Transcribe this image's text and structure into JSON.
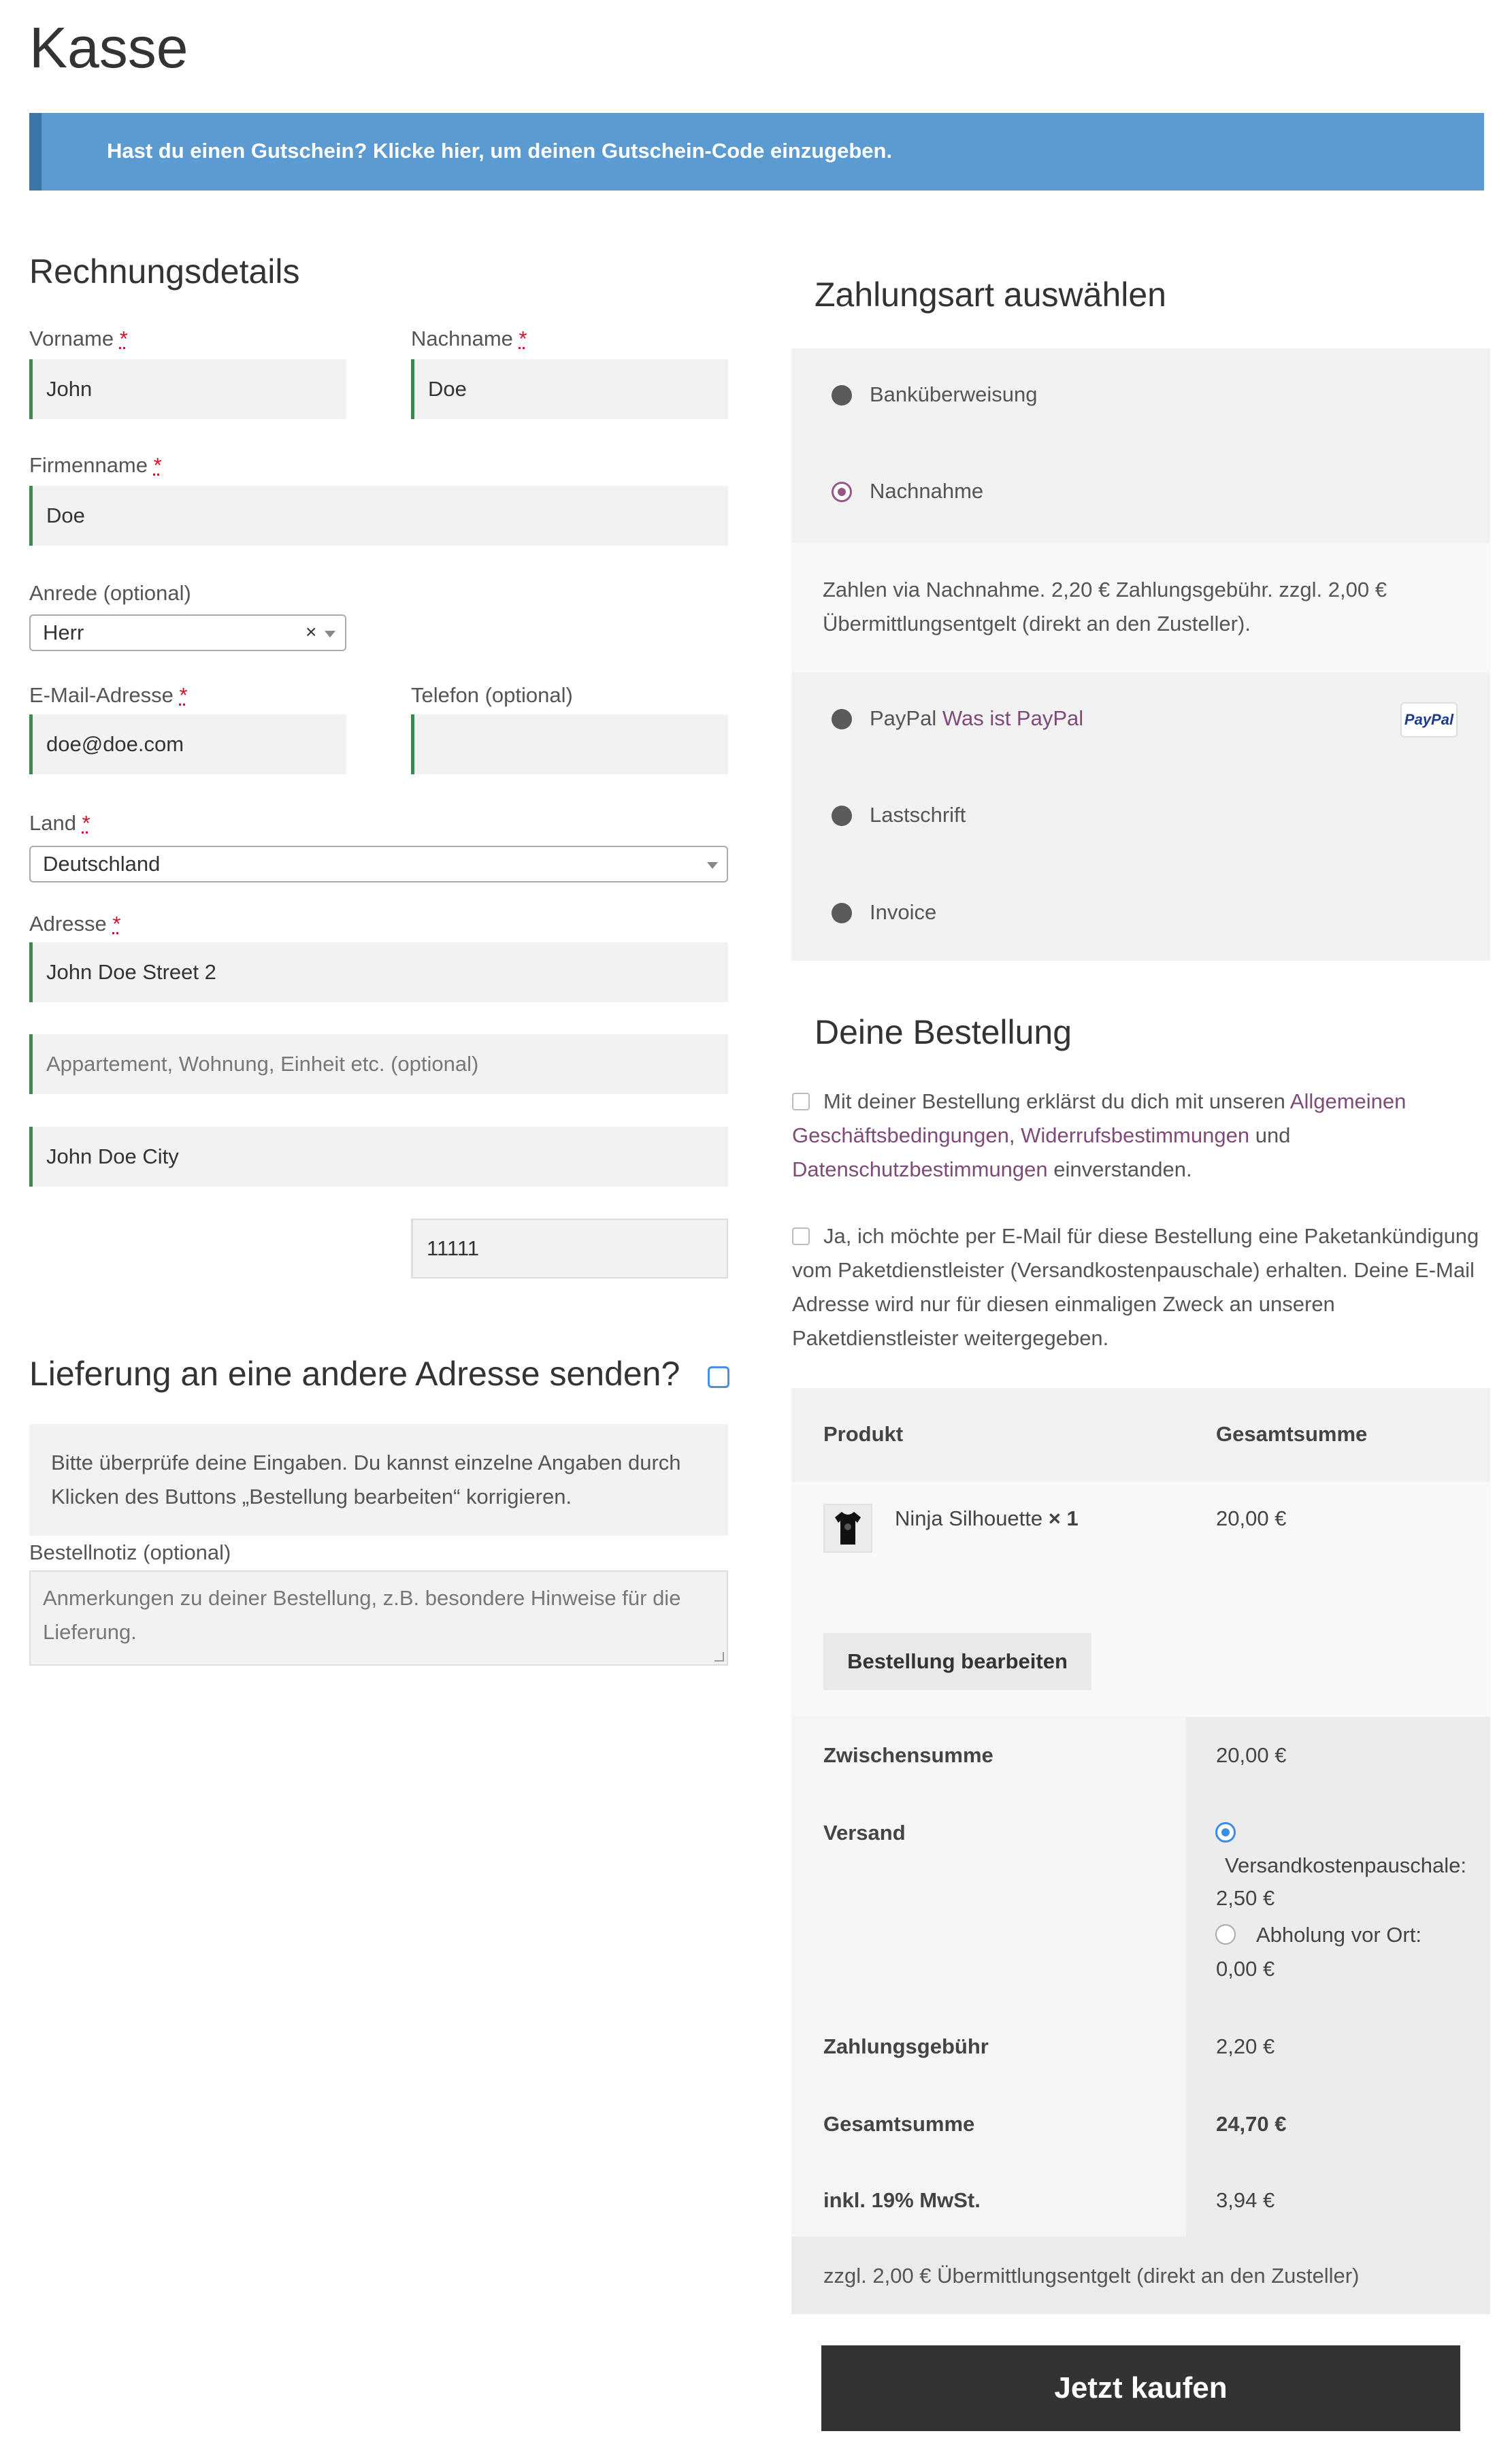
{
  "page": {
    "title": "Kasse",
    "coupon_notice": "Hast du einen Gutschein? Klicke hier, um deinen Gutschein-Code einzugeben."
  },
  "billing": {
    "heading": "Rechnungsdetails",
    "required_mark": "*",
    "first_name": {
      "label": "Vorname",
      "value": "John"
    },
    "last_name": {
      "label": "Nachname",
      "value": "Doe"
    },
    "company": {
      "label": "Firmenname",
      "value": "Doe"
    },
    "salutation": {
      "label": "Anrede (optional)",
      "value": "Herr",
      "clear": "×"
    },
    "email": {
      "label": "E-Mail-Adresse",
      "value": "doe@doe.com"
    },
    "phone": {
      "label": "Telefon (optional)",
      "value": ""
    },
    "country": {
      "label": "Land",
      "value": "Deutschland"
    },
    "address": {
      "label": "Adresse",
      "street": "John Doe Street 2",
      "apartment_placeholder": "Appartement, Wohnung, Einheit etc. (optional)",
      "city": "John Doe City",
      "postcode": "11111"
    }
  },
  "shipping": {
    "heading": "Lieferung an eine andere Adresse senden?"
  },
  "review_notice": {
    "line1": "Bitte überprüfe deine Eingaben. Du kannst einzelne Angaben durch",
    "line2": "Klicken des Buttons „Bestellung bearbeiten“ korrigieren."
  },
  "order_note": {
    "label": "Bestellnotiz (optional)",
    "placeholder_line1": "Anmerkungen zu deiner Bestellung, z.B. besondere Hinweise für die",
    "placeholder_line2": "Lieferung."
  },
  "payment": {
    "heading": "Zahlungsart auswählen",
    "methods": [
      {
        "label": "Banküberweisung"
      },
      {
        "label": "Nachnahme",
        "selected": true
      },
      {
        "label": "PayPal",
        "link": "Was ist PayPal"
      },
      {
        "label": "Lastschrift"
      },
      {
        "label": "Invoice"
      }
    ],
    "cod_description_line1": "Zahlen via Nachnahme. 2,20 € Zahlungsgebühr. zzgl. 2,00 €",
    "cod_description_line2": "Übermittlungsentgelt (direkt an den Zusteller).",
    "paypal_logo_text": "PayPal"
  },
  "order": {
    "heading": "Deine Bestellung",
    "terms": {
      "part1": "Mit deiner Bestellung erklärst du dich mit unseren",
      "link1a": "Allgemeinen",
      "link1b": "Geschäftsbedingungen",
      "sep1": ",",
      "link2": "Widerrufsbestimmungen",
      "part2": "und",
      "link3": "Datenschutzbestimmungen",
      "part3": "einverstanden."
    },
    "parcel_notice": {
      "line1": "Ja, ich möchte per E-Mail für diese Bestellung eine Paketankündigung",
      "line2": "vom Paketdienstleister (Versandkostenpauschale) erhalten. Deine E-Mail",
      "line3": "Adresse wird nur für diesen einmaligen Zweck an unseren",
      "line4": "Paketdienstleister weitergegeben."
    },
    "table": {
      "col_product": "Produkt",
      "col_total": "Gesamtsumme",
      "item_name": "Ninja Silhouette",
      "item_qty": "× 1",
      "item_total": "20,00 €",
      "edit_button": "Bestellung bearbeiten",
      "subtotal_label": "Zwischensumme",
      "subtotal_value": "20,00 €",
      "shipping_label": "Versand",
      "shipping_option1_name": "Versandkostenpauschale:",
      "shipping_option1_price": "2,50 €",
      "shipping_option2_name": "Abholung vor Ort:",
      "shipping_option2_price": "0,00 €",
      "fee_label": "Zahlungsgebühr",
      "fee_value": "2,20 €",
      "total_label": "Gesamtsumme",
      "total_value": "24,70 €",
      "tax_label": "inkl. 19% MwSt.",
      "tax_value": "3,94 €",
      "footnote": "zzgl. 2,00 € Übermittlungsentgelt (direkt an den Zusteller)"
    },
    "buy_button": "Jetzt kaufen"
  },
  "colors": {
    "notice_bg": "#5b9bd1",
    "link": "#7e4a78",
    "valid_border": "#3a8a4c",
    "buy_button_bg": "#333333"
  }
}
